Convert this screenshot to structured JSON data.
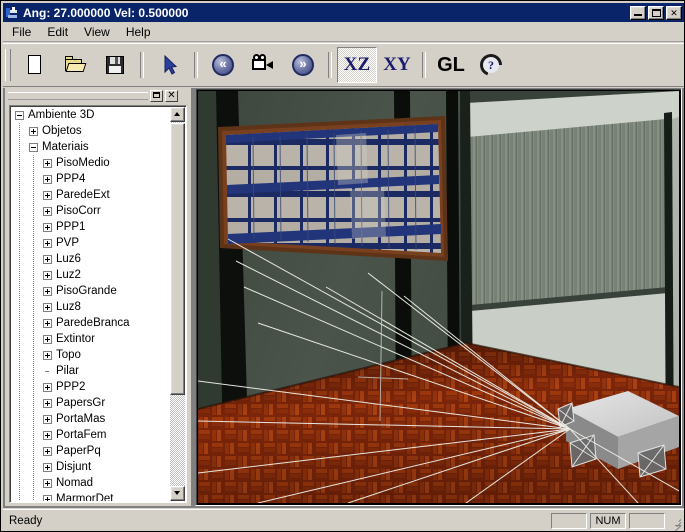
{
  "window": {
    "title": "Ang: 27.000000 Vel: 0.500000",
    "icon": "app-3d-icon",
    "buttons": {
      "minimize": "_",
      "maximize": "□",
      "close": "✕"
    }
  },
  "menu": {
    "items": [
      {
        "label": "File"
      },
      {
        "label": "Edit"
      },
      {
        "label": "View"
      },
      {
        "label": "Help"
      }
    ]
  },
  "toolbar": {
    "buttons": [
      {
        "name": "new-document-button",
        "icon": "new-document-icon",
        "label": "",
        "pressed": false
      },
      {
        "name": "open-file-button",
        "icon": "open-folder-icon",
        "label": "",
        "pressed": false
      },
      {
        "name": "save-button",
        "icon": "floppy-disk-icon",
        "label": "",
        "pressed": false
      },
      {
        "name": "select-pointer-button",
        "icon": "pointer-arrow-icon",
        "label": "",
        "pressed": false
      },
      {
        "name": "previous-step-button",
        "icon": "rewind-icon",
        "label": "«",
        "pressed": false
      },
      {
        "name": "camera-button",
        "icon": "camera-icon",
        "label": "",
        "pressed": false
      },
      {
        "name": "next-step-button",
        "icon": "fast-forward-icon",
        "label": "»",
        "pressed": false
      },
      {
        "name": "view-xz-button",
        "icon": "text-icon",
        "label": "XZ",
        "pressed": true
      },
      {
        "name": "view-xy-button",
        "icon": "text-icon",
        "label": "XY",
        "pressed": false
      },
      {
        "name": "view-gl-button",
        "icon": "text-icon",
        "label": "GL",
        "pressed": false
      },
      {
        "name": "help-button",
        "icon": "question-mark-icon",
        "label": "",
        "pressed": false
      }
    ]
  },
  "panel": {
    "caption_buttons": {
      "maximize": "maximize-icon",
      "close": "✕"
    },
    "tree": [
      {
        "label": "Ambiente 3D",
        "level": 0,
        "state": "expanded"
      },
      {
        "label": "Objetos",
        "level": 1,
        "state": "collapsed"
      },
      {
        "label": "Materiais",
        "level": 1,
        "state": "expanded"
      },
      {
        "label": "PisoMedio",
        "level": 2,
        "state": "collapsed"
      },
      {
        "label": "PPP4",
        "level": 2,
        "state": "collapsed"
      },
      {
        "label": "ParedeExt",
        "level": 2,
        "state": "collapsed"
      },
      {
        "label": "PisoCorr",
        "level": 2,
        "state": "collapsed"
      },
      {
        "label": "PPP1",
        "level": 2,
        "state": "collapsed"
      },
      {
        "label": "PVP",
        "level": 2,
        "state": "collapsed"
      },
      {
        "label": "Luz6",
        "level": 2,
        "state": "collapsed"
      },
      {
        "label": "Luz2",
        "level": 2,
        "state": "collapsed"
      },
      {
        "label": "PisoGrande",
        "level": 2,
        "state": "collapsed"
      },
      {
        "label": "Luz8",
        "level": 2,
        "state": "collapsed"
      },
      {
        "label": "ParedeBranca",
        "level": 2,
        "state": "collapsed"
      },
      {
        "label": "Extintor",
        "level": 2,
        "state": "collapsed"
      },
      {
        "label": "Topo",
        "level": 2,
        "state": "collapsed"
      },
      {
        "label": "Pilar",
        "level": 2,
        "state": "leaf"
      },
      {
        "label": "PPP2",
        "level": 2,
        "state": "collapsed"
      },
      {
        "label": "PapersGr",
        "level": 2,
        "state": "collapsed"
      },
      {
        "label": "PortaMas",
        "level": 2,
        "state": "collapsed"
      },
      {
        "label": "PortaFem",
        "level": 2,
        "state": "collapsed"
      },
      {
        "label": "PaperPq",
        "level": 2,
        "state": "collapsed"
      },
      {
        "label": "Disjunt",
        "level": 2,
        "state": "collapsed"
      },
      {
        "label": "Nomad",
        "level": 2,
        "state": "collapsed"
      },
      {
        "label": "MarmorDet",
        "level": 2,
        "state": "collapsed"
      }
    ]
  },
  "viewport": {
    "scene_name": "ambiente-3d-render",
    "colors": {
      "wall": "#454f44",
      "wall_dark": "#2f382f",
      "floor": "#a8310d",
      "floor_dark": "#6e1f08",
      "pillar": "#0b0d0b",
      "board_frame": "#6b3a1e",
      "board_band": "#22357a",
      "paper": "#b8b2aa",
      "blinds": "#8f9a8b",
      "robot_top": "#d8d8d8",
      "robot_side": "#8c8c8c",
      "ray": "#f2f2ee"
    }
  },
  "statusbar": {
    "message": "Ready",
    "panels": [
      {
        "name": "status-panel-empty-1",
        "label": ""
      },
      {
        "name": "status-panel-num",
        "label": "NUM"
      },
      {
        "name": "status-panel-empty-2",
        "label": ""
      }
    ]
  }
}
